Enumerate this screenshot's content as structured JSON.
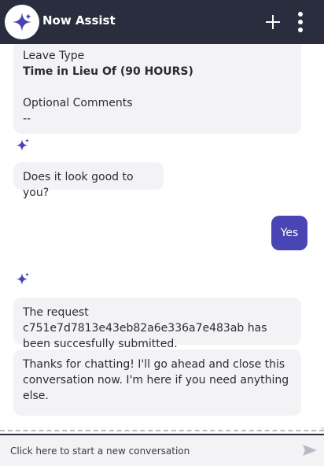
{
  "header": {
    "title": "Now Assist",
    "logo_icon": "sparkle-icon",
    "add_icon": "plus-icon",
    "menu_icon": "more-vertical-icon"
  },
  "messages": {
    "summary": {
      "leave_type_label": "Leave Type",
      "leave_type_value": "Time in Lieu Of (90 HOURS)",
      "comments_label": "Optional Comments",
      "comments_value": "--"
    },
    "confirm_prompt": "Does it look good to you?",
    "user_reply": "Yes",
    "submitted": "The request c751e7d7813e43eb82a6e336a7e483ab has been succesfully submitted.",
    "closing": "Thanks for chatting! I'll go ahead and close this conversation now. I'm here if you need anything else."
  },
  "footer": {
    "new_conversation": "Click here to start a new conversation",
    "send_icon": "send-icon"
  },
  "colors": {
    "header_bg": "#2a2d3e",
    "accent": "#4a45b4",
    "bubble_bg": "#f3f3f5"
  }
}
